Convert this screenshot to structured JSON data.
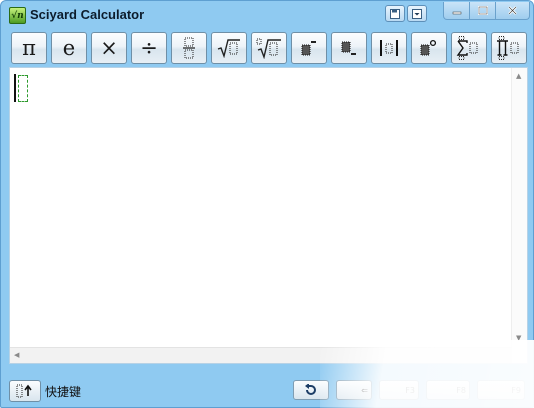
{
  "window": {
    "title": "Sciyard Calculator",
    "app_icon_text": "√n"
  },
  "toolbar": {
    "pi_label": "π",
    "e_label": "e",
    "times_label": "×",
    "divide_label": "÷"
  },
  "statusbar": {
    "shortcut_label": "快捷键",
    "undo_key": "",
    "f3_key": "F3",
    "f8_key": "F8",
    "f9_key": "F9"
  },
  "colors": {
    "frame": "#8fcaf1",
    "placeholder_green": "#2e9a2e"
  }
}
